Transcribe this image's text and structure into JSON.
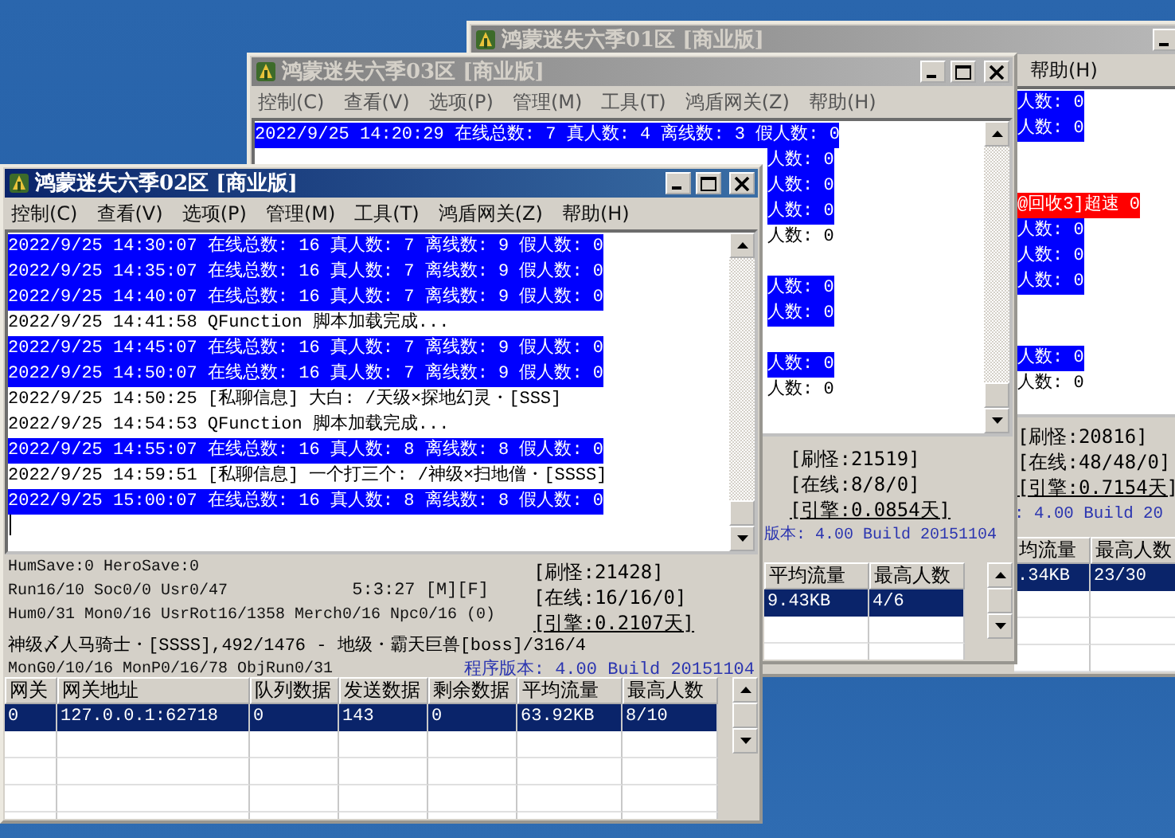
{
  "windows": [
    {
      "title": "鸿蒙迷失六季01区 [商业版]",
      "active": false,
      "menu": {
        "cut": true,
        "items": [
          "帮助(H)"
        ]
      },
      "log": [
        {
          "text": "人数: 0",
          "color": "#0000ff",
          "cut": true
        },
        {
          "text": "人数: 0",
          "color": "#0000ff",
          "cut": true
        },
        {
          "covered": true
        },
        {
          "covered": true
        },
        {
          "text": "@回收3]超速 0",
          "color": "#ff0000",
          "cut": true
        },
        {
          "text": "人数: 0",
          "color": "#0000ff",
          "cut": true
        },
        {
          "text": "人数: 0",
          "color": "#0000ff",
          "cut": true
        },
        {
          "text": "人数: 0",
          "color": "#0000ff",
          "cut": true
        },
        {
          "covered": true
        },
        {
          "covered": true
        },
        {
          "text": "人数: 0",
          "color": "#0000ff",
          "cut": true
        },
        {
          "text": "人数: 0",
          "color": "#ffffff",
          "cut": true
        }
      ],
      "status": {
        "cut": true,
        "counters": [
          "[刷怪:20816]",
          "[在线:48/48/0]",
          "[引擎:0.7154天]"
        ],
        "version": ": 4.00 Build 20"
      },
      "table": {
        "cut": true,
        "columns": [
          "均流量",
          "最高人数"
        ],
        "rows": [
          {
            "cells": [
              ".34KB",
              "23/30"
            ],
            "selected": true
          }
        ]
      }
    },
    {
      "title": "鸿蒙迷失六季03区 [商业版]",
      "active": false,
      "menu": {
        "cut": false,
        "items": [
          "控制(C)",
          "查看(V)",
          "选项(P)",
          "管理(M)",
          "工具(T)",
          "鸿盾网关(Z)",
          "帮助(H)"
        ]
      },
      "log": [
        {
          "text": "2022/9/25 14:20:29 在线总数: 7 真人数: 4 离线数: 3 假人数: 0",
          "color": "#0000ff",
          "cut": false
        },
        {
          "text": "人数: 0",
          "color": "#0000ff",
          "cut": true
        },
        {
          "text": "人数: 0",
          "color": "#0000ff",
          "cut": true
        },
        {
          "text": "人数: 0",
          "color": "#0000ff",
          "cut": true
        },
        {
          "text": "人数: 0",
          "color": "#ffffff",
          "cut": true
        },
        {
          "covered": true
        },
        {
          "text": "人数: 0",
          "color": "#0000ff",
          "cut": true
        },
        {
          "text": "人数: 0",
          "color": "#0000ff",
          "cut": true
        },
        {
          "covered": true
        },
        {
          "text": "人数: 0",
          "color": "#0000ff",
          "cut": true
        },
        {
          "text": "人数: 0",
          "color": "#ffffff",
          "cut": true
        }
      ],
      "status": {
        "cut": true,
        "counters": [
          "[刷怪:21519]",
          "[在线:8/8/0]",
          "[引擎:0.0854天]"
        ],
        "version": "版本: 4.00 Build 20151104"
      },
      "table": {
        "cut": true,
        "columns": [
          "平均流量",
          "最高人数"
        ],
        "rows": [
          {
            "cells": [
              "9.43KB",
              "4/6"
            ],
            "selected": true
          }
        ]
      }
    },
    {
      "title": "鸿蒙迷失六季02区 [商业版]",
      "active": true,
      "menu": {
        "cut": false,
        "items": [
          "控制(C)",
          "查看(V)",
          "选项(P)",
          "管理(M)",
          "工具(T)",
          "鸿盾网关(Z)",
          "帮助(H)"
        ]
      },
      "log": [
        {
          "text": "2022/9/25 14:30:07 在线总数: 16 真人数: 7 离线数: 9 假人数: 0",
          "color": "#0000ff"
        },
        {
          "text": "2022/9/25 14:35:07 在线总数: 16 真人数: 7 离线数: 9 假人数: 0",
          "color": "#0000ff"
        },
        {
          "text": "2022/9/25 14:40:07 在线总数: 16 真人数: 7 离线数: 9 假人数: 0",
          "color": "#0000ff"
        },
        {
          "text": "2022/9/25 14:41:58 QFunction 脚本加载完成...",
          "color": "#ffffff"
        },
        {
          "text": "2022/9/25 14:45:07 在线总数: 16 真人数: 7 离线数: 9 假人数: 0",
          "color": "#0000ff"
        },
        {
          "text": "2022/9/25 14:50:07 在线总数: 16 真人数: 7 离线数: 9 假人数: 0",
          "color": "#0000ff"
        },
        {
          "text": "2022/9/25 14:50:25 [私聊信息] 大白: /天级×探地幻灵・[SSS]",
          "color": "#ffffff"
        },
        {
          "text": "2022/9/25 14:54:53 QFunction 脚本加载完成...",
          "color": "#ffffff"
        },
        {
          "text": "2022/9/25 14:55:07 在线总数: 16 真人数: 8 离线数: 8 假人数: 0",
          "color": "#0000ff"
        },
        {
          "text": "2022/9/25 14:59:51 [私聊信息] 一个打三个: /神级×扫地僧・[SSSS]",
          "color": "#ffffff"
        },
        {
          "text": "2022/9/25 15:00:07 在线总数: 16 真人数: 8 离线数: 8 假人数: 0",
          "color": "#0000ff"
        }
      ],
      "status": {
        "cut": false,
        "lines": [
          {
            "text": "HumSave:0 HeroSave:0"
          },
          {
            "text": "Run16/10 Soc0/0 Usr0/47",
            "clock": "5:3:27 [M][F]"
          },
          {
            "text": "Hum0/31 Mon0/16 UsrRot16/1358 Merch0/16 Npc0/16 (0)"
          },
          {
            "text": "神级〆人马骑士・[SSSS],492/1476 - 地级・霸天巨兽[boss]/316/4"
          },
          {
            "text": "MonG0/10/16 MonP0/16/78 ObjRun0/31"
          }
        ],
        "counters": [
          "[刷怪:21428]",
          "[在线:16/16/0]",
          "[引擎:0.2107天]"
        ],
        "version": "程序版本: 4.00 Build 20151104"
      },
      "table": {
        "cut": false,
        "columns": [
          "网关",
          "网关地址",
          "队列数据",
          "发送数据",
          "剩余数据",
          "平均流量",
          "最高人数"
        ],
        "rows": [
          {
            "cells": [
              "0",
              "127.0.0.1:62718",
              "0",
              "143",
              "0",
              "63.92KB",
              "8/10"
            ],
            "selected": true
          }
        ]
      }
    }
  ]
}
